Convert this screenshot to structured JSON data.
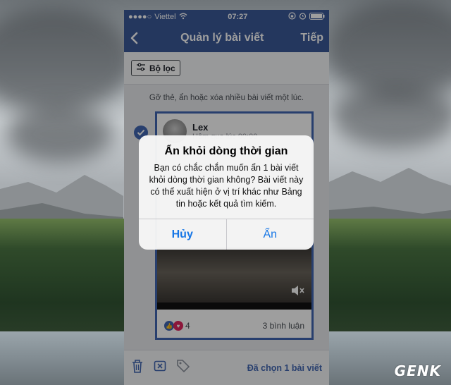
{
  "status": {
    "carrier_dots": "●●●●○",
    "carrier": "Viettel",
    "time": "07:27",
    "icons": [
      "wifi-icon",
      "lock-rotation-icon",
      "alarm-icon",
      "battery-icon"
    ]
  },
  "navbar": {
    "back_icon": "chevron-left-icon",
    "title": "Quản lý bài viết",
    "next_label": "Tiếp"
  },
  "filter": {
    "icon": "sliders-icon",
    "label": "Bộ lọc"
  },
  "hint": "Gỡ thẻ, ẩn hoặc xóa nhiều bài viết một lúc.",
  "post": {
    "selected": true,
    "author": "Lex",
    "time": "Hôm qua lúc 00:00",
    "reaction_count": "4",
    "comments": "3 bình luận"
  },
  "bottombar": {
    "icons": [
      "trash-icon",
      "hide-icon",
      "tag-remove-icon"
    ],
    "selected_label": "Đã chọn 1 bài viết"
  },
  "alert": {
    "title": "Ẩn khỏi dòng thời gian",
    "message": "Bạn có chắc chắn muốn ẩn 1 bài viết khỏi dòng thời gian không? Bài viết này có thể xuất hiện ở vị trí khác như Bảng tin hoặc kết quả tìm kiếm.",
    "cancel_label": "Hủy",
    "confirm_label": "Ẩn"
  },
  "watermark": "GENK",
  "colors": {
    "facebook_blue": "#3b5998",
    "accent_blue": "#4267b2",
    "ios_link_blue": "#1676e6"
  }
}
